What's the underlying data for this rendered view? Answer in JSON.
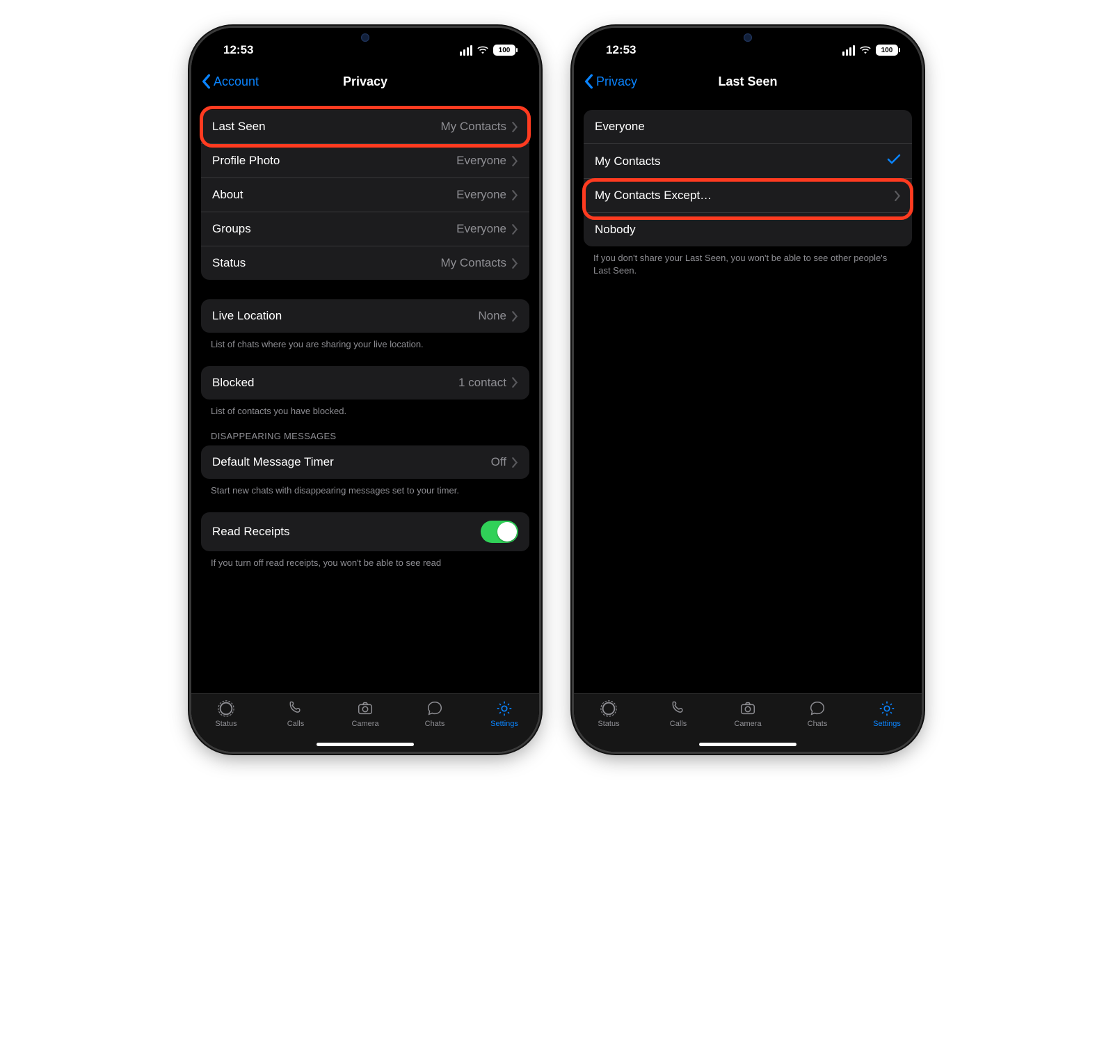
{
  "statusbar": {
    "time": "12:53",
    "battery": "100"
  },
  "tabs": {
    "status": "Status",
    "calls": "Calls",
    "camera": "Camera",
    "chats": "Chats",
    "settings": "Settings"
  },
  "phone_left": {
    "back_label": "Account",
    "title": "Privacy",
    "rows_main": [
      {
        "label": "Last Seen",
        "value": "My Contacts"
      },
      {
        "label": "Profile Photo",
        "value": "Everyone"
      },
      {
        "label": "About",
        "value": "Everyone"
      },
      {
        "label": "Groups",
        "value": "Everyone"
      },
      {
        "label": "Status",
        "value": "My Contacts"
      }
    ],
    "live_location": {
      "label": "Live Location",
      "value": "None"
    },
    "live_location_footer": "List of chats where you are sharing your live location.",
    "blocked": {
      "label": "Blocked",
      "value": "1 contact"
    },
    "blocked_footer": "List of contacts you have blocked.",
    "disappearing_header": "DISAPPEARING MESSAGES",
    "default_timer": {
      "label": "Default Message Timer",
      "value": "Off"
    },
    "default_timer_footer": "Start new chats with disappearing messages set to your timer.",
    "read_receipts_label": "Read Receipts",
    "read_receipts_footer_partial": "If you turn off read receipts, you won't be able to see read"
  },
  "phone_right": {
    "back_label": "Privacy",
    "title": "Last Seen",
    "options": [
      {
        "label": "Everyone",
        "checked": false,
        "chevron": false
      },
      {
        "label": "My Contacts",
        "checked": true,
        "chevron": false
      },
      {
        "label": "My Contacts Except…",
        "checked": false,
        "chevron": true
      },
      {
        "label": "Nobody",
        "checked": false,
        "chevron": false
      }
    ],
    "footer": "If you don't share your Last Seen, you won't be able to see other people's Last Seen."
  }
}
